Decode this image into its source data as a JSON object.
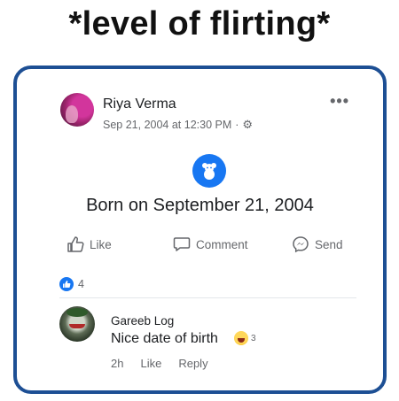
{
  "meme": {
    "caption": "*level of flirting*"
  },
  "post": {
    "author": "Riya Verma",
    "timestamp": "Sep 21, 2004 at 12:30 PM",
    "separator": "·",
    "audience_icon": "gear-icon",
    "more_label": "•••",
    "event_icon": "teddy-bear-icon",
    "event_text": "Born on September 21, 2004",
    "actions": {
      "like": "Like",
      "comment": "Comment",
      "send": "Send"
    },
    "reaction_count": "4"
  },
  "comment": {
    "author": "Gareeb Log",
    "text": "Nice date of birth",
    "reaction_icon": "haha-emoji",
    "reaction_count": "3",
    "time": "2h",
    "like": "Like",
    "reply": "Reply"
  },
  "colors": {
    "accent": "#1877f2",
    "frame": "#1d4f94",
    "meta": "#65676b"
  }
}
